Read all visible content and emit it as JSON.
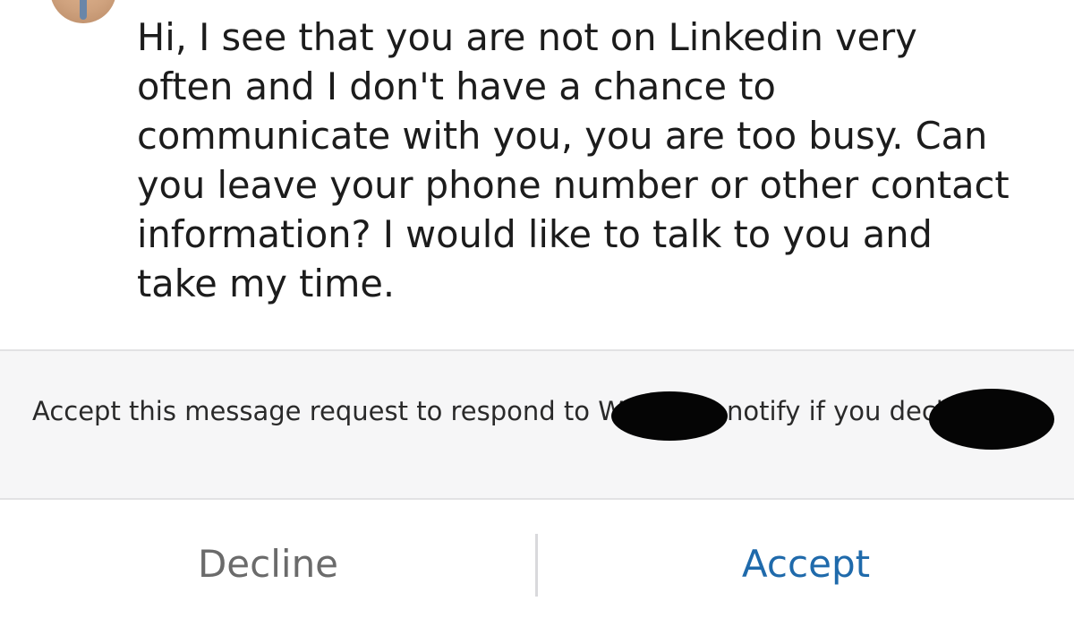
{
  "message": {
    "text": "Hi, I see that you are not on Linkedin very often and I don't have a chance to communicate with you, you are too busy. Can you leave your phone number or other contact information? I would like to talk to you and take my time."
  },
  "request": {
    "text_part1": "Accept this message request to respond to",
    "text_part2": "We won’t notify",
    "text_part3": "if you decline."
  },
  "actions": {
    "decline_label": "Decline",
    "accept_label": "Accept"
  },
  "colors": {
    "accept": "#1f6aab",
    "decline": "#6b6b6b",
    "panel_background": "#f6f6f7",
    "redaction": "#050505"
  }
}
